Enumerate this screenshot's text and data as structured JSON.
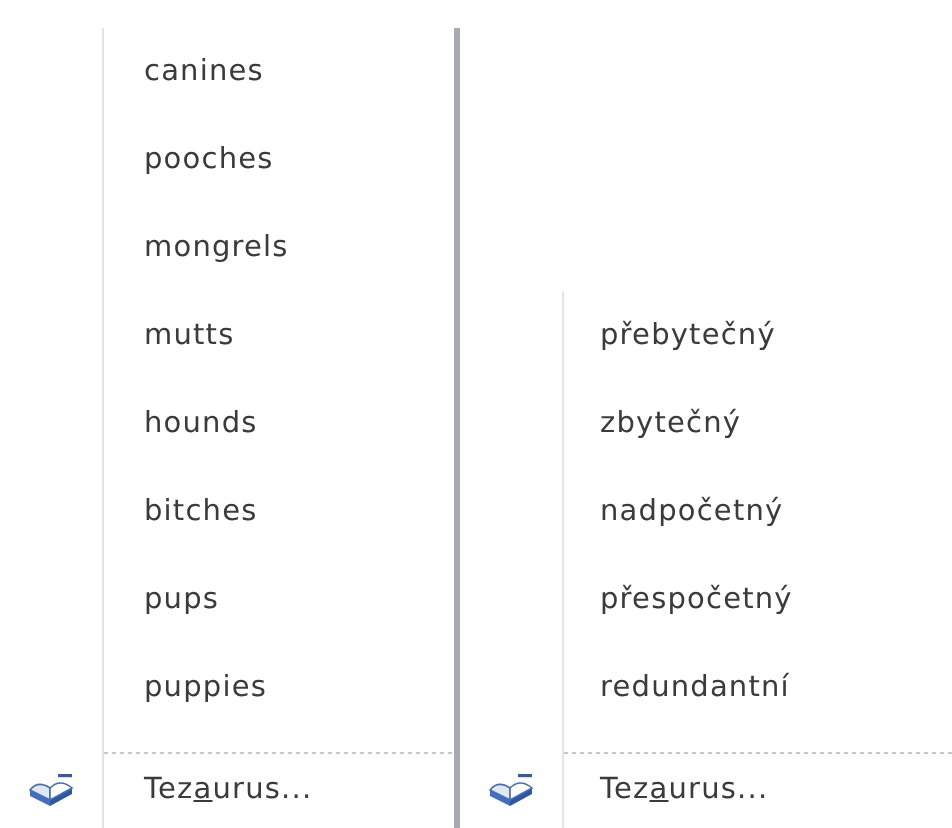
{
  "menus": [
    {
      "items": [
        "canines",
        "pooches",
        "mongrels",
        "mutts",
        "hounds",
        "bitches",
        "pups",
        "puppies"
      ],
      "footer": {
        "parts": [
          {
            "text": "Tez",
            "underlined": false
          },
          {
            "text": "a",
            "underlined": true
          },
          {
            "text": "urus...",
            "underlined": false
          }
        ]
      }
    },
    {
      "items": [
        "přebytečný",
        "zbytečný",
        "nadpočetný",
        "přespočetný",
        "redundantní"
      ],
      "footer": {
        "parts": [
          {
            "text": "Tez",
            "underlined": false
          },
          {
            "text": "a",
            "underlined": true
          },
          {
            "text": "urus...",
            "underlined": false
          }
        ]
      }
    }
  ]
}
